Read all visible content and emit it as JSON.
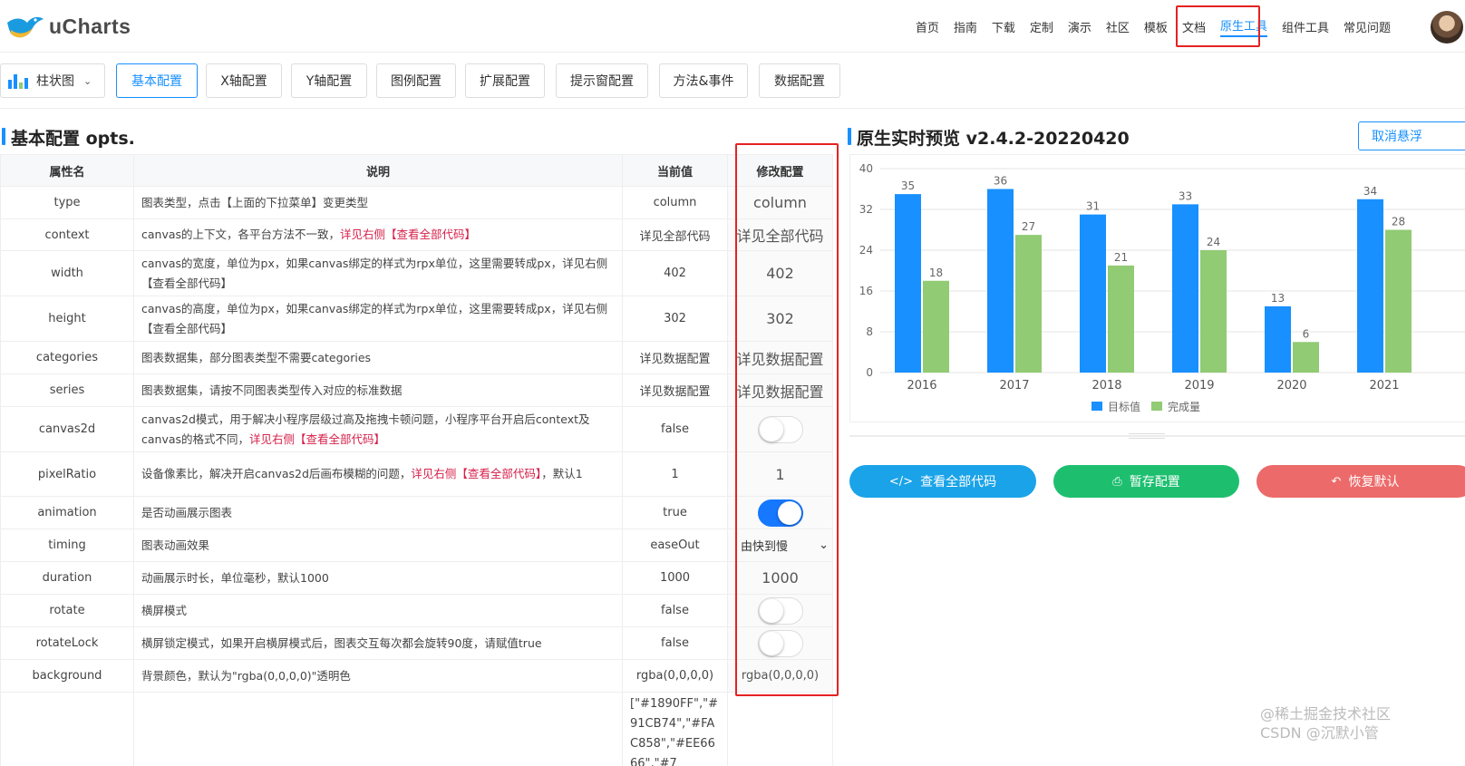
{
  "brand": {
    "name": "uCharts"
  },
  "nav": {
    "items": [
      "首页",
      "指南",
      "下载",
      "定制",
      "演示",
      "社区",
      "模板",
      "文档",
      "原生工具",
      "组件工具",
      "常见问题"
    ],
    "active_index": 8
  },
  "toolbar": {
    "chart_type": "柱状图",
    "tabs": [
      "基本配置",
      "X轴配置",
      "Y轴配置",
      "图例配置",
      "扩展配置",
      "提示窗配置",
      "方法&事件",
      "数据配置"
    ],
    "active_tab": 0
  },
  "left": {
    "title": "基本配置 opts.",
    "headers": [
      "属性名",
      "说明",
      "当前值",
      "修改配置"
    ],
    "rows": [
      {
        "name": "type",
        "desc": "图表类型，点击【上面的下拉菜单】变更类型",
        "desc_link": "",
        "desc_tail": "",
        "current": "column",
        "modify": "column",
        "control": "text"
      },
      {
        "name": "context",
        "desc": "canvas的上下文，各平台方法不一致，",
        "desc_link": "详见右侧【查看全部代码】",
        "desc_tail": "",
        "current": "详见全部代码",
        "modify": "详见全部代码",
        "control": "text"
      },
      {
        "name": "width",
        "desc": "canvas的宽度，单位为px，如果canvas绑定的样式为rpx单位，这里需要转成px，详见右侧【查看全部代码】",
        "desc_link": "",
        "desc_tail": "",
        "current": "402",
        "modify": "402",
        "control": "text"
      },
      {
        "name": "height",
        "desc": "canvas的高度，单位为px，如果canvas绑定的样式为rpx单位，这里需要转成px，详见右侧【查看全部代码】",
        "desc_link": "",
        "desc_tail": "",
        "current": "302",
        "modify": "302",
        "control": "text"
      },
      {
        "name": "categories",
        "desc": "图表数据集，部分图表类型不需要categories",
        "desc_link": "",
        "desc_tail": "",
        "current": "详见数据配置",
        "modify": "详见数据配置",
        "control": "text"
      },
      {
        "name": "series",
        "desc": "图表数据集，请按不同图表类型传入对应的标准数据",
        "desc_link": "",
        "desc_tail": "",
        "current": "详见数据配置",
        "modify": "详见数据配置",
        "control": "text"
      },
      {
        "name": "canvas2d",
        "desc": "canvas2d模式，用于解决小程序层级过高及拖拽卡顿问题，小程序平台开启后context及canvas的格式不同，",
        "desc_link": "详见右侧【查看全部代码】",
        "desc_tail": "",
        "current": "false",
        "modify": false,
        "control": "switch"
      },
      {
        "name": "pixelRatio",
        "desc": "设备像素比，解决开启canvas2d后画布模糊的问题，",
        "desc_link": "详见右侧【查看全部代码】",
        "desc_tail": "，默认1",
        "current": "1",
        "modify": "1",
        "control": "text"
      },
      {
        "name": "animation",
        "desc": "是否动画展示图表",
        "desc_link": "",
        "desc_tail": "",
        "current": "true",
        "modify": true,
        "control": "switch"
      },
      {
        "name": "timing",
        "desc": "图表动画效果",
        "desc_link": "",
        "desc_tail": "",
        "current": "easeOut",
        "modify": "由快到慢",
        "control": "select"
      },
      {
        "name": "duration",
        "desc": "动画展示时长，单位毫秒，默认1000",
        "desc_link": "",
        "desc_tail": "",
        "current": "1000",
        "modify": "1000",
        "control": "text"
      },
      {
        "name": "rotate",
        "desc": "横屏模式",
        "desc_link": "",
        "desc_tail": "",
        "current": "false",
        "modify": false,
        "control": "switch"
      },
      {
        "name": "rotateLock",
        "desc": "横屏锁定模式，如果开启横屏模式后，图表交互每次都会旋转90度，请赋值true",
        "desc_link": "",
        "desc_tail": "",
        "current": "false",
        "modify": false,
        "control": "switch"
      },
      {
        "name": "background",
        "desc": "背景颜色，默认为\"rgba(0,0,0,0)\"透明色",
        "desc_link": "",
        "desc_tail": "",
        "current": "rgba(0,0,0,0)",
        "modify": "rgba(0,0,0,0)",
        "control": "text-small"
      },
      {
        "name": "",
        "desc": "",
        "desc_link": "",
        "desc_tail": "",
        "current": "[\"#1890FF\",\"#91CB74\",\"#FAC858\",\"#EE6666\",\"#7",
        "modify": "",
        "control": "colors"
      }
    ]
  },
  "right": {
    "title": "原生实时预览 v2.4.2-20220420",
    "cancel_button": "取消悬浮",
    "buttons": [
      {
        "label": "查看全部代码",
        "icon": "code-icon",
        "color": "#1aa3e8"
      },
      {
        "label": "暂存配置",
        "icon": "save-icon",
        "color": "#1dbf6f"
      },
      {
        "label": "恢复默认",
        "icon": "undo-icon",
        "color": "#ec6a6a"
      }
    ]
  },
  "chart_data": {
    "type": "bar",
    "categories": [
      "2016",
      "2017",
      "2018",
      "2019",
      "2020",
      "2021"
    ],
    "series": [
      {
        "name": "目标值",
        "values": [
          35,
          36,
          31,
          33,
          13,
          34
        ],
        "color": "#1890FF"
      },
      {
        "name": "完成量",
        "values": [
          18,
          27,
          21,
          24,
          6,
          28
        ],
        "color": "#91CB74"
      }
    ],
    "ylim": [
      0,
      40
    ],
    "yticks": [
      0,
      8,
      16,
      24,
      32,
      40
    ],
    "grid": true,
    "legend_position": "bottom"
  },
  "watermark": {
    "line1": "@稀土掘金技术社区",
    "line2": "CSDN @沉默小管"
  }
}
